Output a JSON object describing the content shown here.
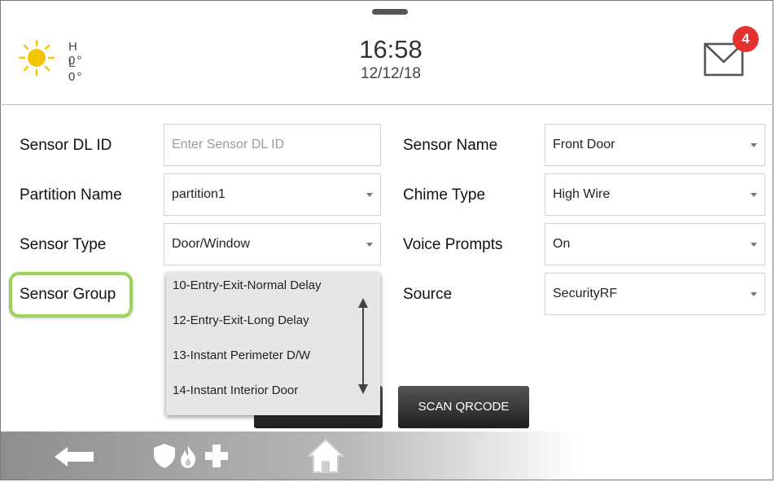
{
  "header": {
    "weather": {
      "icon": "sun-icon",
      "high": "H 0°",
      "low": "L 0°"
    },
    "time": "16:58",
    "date": "12/12/18",
    "messages": {
      "icon": "mail-icon",
      "count": "4"
    }
  },
  "form": {
    "sensor_dl_id": {
      "label": "Sensor DL ID",
      "placeholder": "Enter Sensor DL ID",
      "value": ""
    },
    "sensor_name": {
      "label": "Sensor Name",
      "value": "Front Door"
    },
    "partition_name": {
      "label": "Partition Name",
      "value": "partition1"
    },
    "chime_type": {
      "label": "Chime Type",
      "value": "High Wire"
    },
    "sensor_type": {
      "label": "Sensor Type",
      "value": "Door/Window"
    },
    "voice_prompts": {
      "label": "Voice Prompts",
      "value": "On"
    },
    "sensor_group": {
      "label": "Sensor Group",
      "options": [
        "10-Entry-Exit-Normal Delay",
        "12-Entry-Exit-Long Delay",
        "13-Instant Perimeter D/W",
        "14-Instant Interior Door"
      ]
    },
    "source": {
      "label": "Source",
      "value": "SecurityRF"
    }
  },
  "buttons": {
    "scan_qrcode": "SCAN QRCODE"
  },
  "navbar": {
    "icons": [
      "back-arrow-icon",
      "shield-icon",
      "fire-icon",
      "medical-cross-icon",
      "home-icon"
    ]
  },
  "colors": {
    "highlight": "#9ed35a",
    "badge": "#e53030",
    "sun": "#f5c400"
  }
}
